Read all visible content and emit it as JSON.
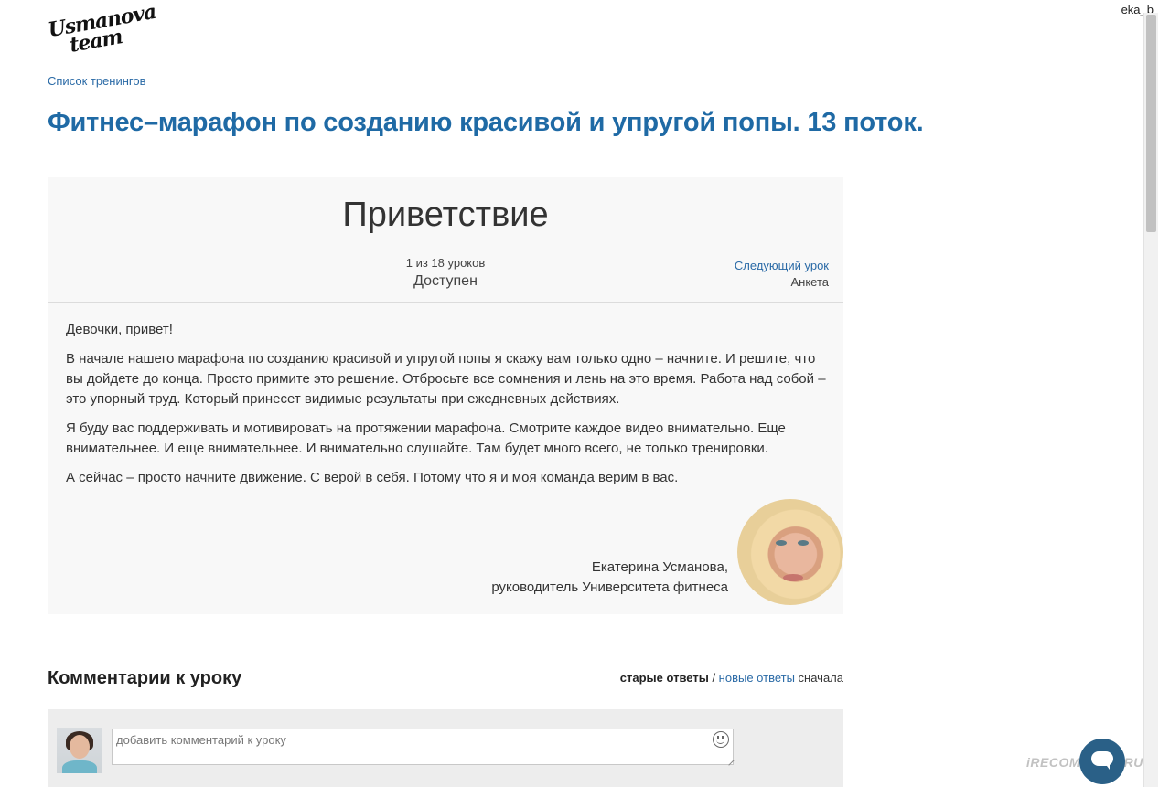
{
  "header": {
    "username": "eka_b",
    "logo_line1": "Usmanova",
    "logo_line2": "team"
  },
  "breadcrumb": {
    "label": "Список тренингов"
  },
  "page_title": "Фитнес–марафон по созданию красивой и упругой попы. 13 поток.",
  "lesson": {
    "title": "Приветствие",
    "count": "1 из 18 уроков",
    "status": "Доступен",
    "next_link": "Следующий урок",
    "next_name": "Анкета",
    "paragraphs": [
      "Девочки, привет!",
      "В начале нашего марафона по созданию красивой и упругой попы я скажу вам только одно – начните. И решите, что вы дойдете до конца. Просто примите это решение. Отбросьте все сомнения и лень на это время. Работа над собой – это упорный труд. Который принесет видимые результаты при ежедневных действиях.",
      "Я буду вас поддерживать и мотивировать на протяжении марафона. Смотрите каждое видео внимательно. Еще внимательнее. И еще внимательнее. И внимательно слушайте. Там будет много всего, не только тренировки.",
      "А сейчас – просто начните движение. С верой в себя. Потому что я и моя команда верим в вас."
    ],
    "author_name": "Екатерина Усманова,",
    "author_role": "руководитель Университета фитнеса"
  },
  "comments": {
    "title": "Комментарии к уроку",
    "sort_active": "старые ответы",
    "sort_separator": " / ",
    "sort_link": "новые ответы",
    "sort_suffix": " сначала",
    "input_placeholder": "добавить комментарий к уроку"
  },
  "watermark": "iRECOMMEND.RU"
}
